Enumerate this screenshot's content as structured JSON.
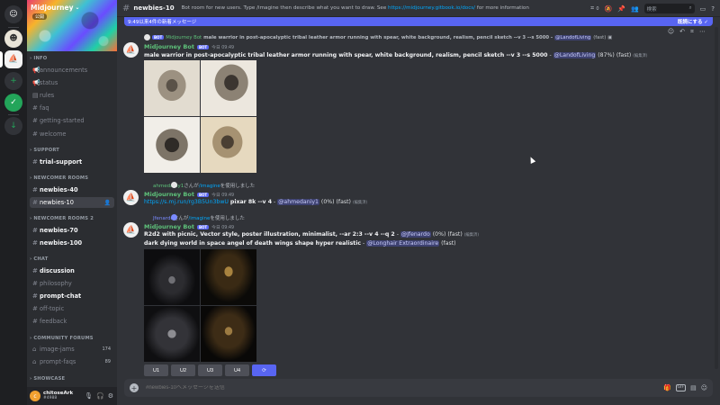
{
  "server": {
    "name": "Midjourney",
    "badge": "公開"
  },
  "categories": {
    "info": "INFO",
    "support": "SUPPORT",
    "newcomer1": "NEWCOMER ROOMS",
    "newcomer2": "NEWCOMER ROOMS 2",
    "chat": "CHAT",
    "forums": "COMMUNITY FORUMS",
    "showcase": "SHOWCASE"
  },
  "channels": {
    "announcements": "announcements",
    "status": "status",
    "rules": "rules",
    "faq": "faq",
    "getting_started": "getting-started",
    "welcome": "welcome",
    "trial_support": "trial-support",
    "newbies40": "newbies-40",
    "newbies10": "newbies-10",
    "newbies70": "newbies-70",
    "newbies100": "newbies-100",
    "discussion": "discussion",
    "philosophy": "philosophy",
    "prompt_chat": "prompt-chat",
    "off_topic": "off-topic",
    "feedback": "feedback",
    "image_jams": "image-jams",
    "image_jams_count": "174",
    "prompt_faqs": "prompt-faqs",
    "prompt_faqs_count": "89"
  },
  "user": {
    "name": "chitoseArk",
    "tag": "#4988",
    "initial": "c"
  },
  "topbar": {
    "channel": "newbies-10",
    "topic_prefix": "Bot room for new users. Type /imagine then describe what you want to draw. See ",
    "topic_link": "https://midjourney.gitbook.io/docs/",
    "topic_suffix": " for more information",
    "search_placeholder": "検索",
    "thread_count": "0"
  },
  "newbar": {
    "text": "9:49以来4件の新着メッセージ",
    "mark": "既読にする"
  },
  "messages": {
    "m1": {
      "reply_author": "Midjourney Bot",
      "reply_badge": "BOT",
      "reply_text": "male warrior in post-apocalyptic tribal leather armor running with spear, white background, realism, pencil sketch --v 3 --s 5000 -",
      "reply_mention": "@LandofLiving",
      "reply_status": "(fast)",
      "author": "Midjourney Bot",
      "badge": "BOT",
      "time": "今日 09:49",
      "prompt": "male warrior in post-apocalyptic tribal leather armor running with spear, white background, realism, pencil sketch --v 3 --s 5000",
      "dash": "-",
      "mention": "@LandofLiving",
      "status": "(87%) (fast)",
      "edited": "(編集済)"
    },
    "sys1": {
      "user": "ahmedaniy1",
      "action": "さんが",
      "command": "/imagine",
      "suffix": "を使用しました"
    },
    "m2": {
      "author": "Midjourney Bot",
      "badge": "BOT",
      "time": "今日 09:49",
      "link": "https://s.mj.run/rg3B5Un3bwU",
      "text": "pixar 8k --v 4",
      "dash": "-",
      "mention": "@ahmedaniy1",
      "status": "(0%) (fast)",
      "edited": "(編集済)"
    },
    "sys2": {
      "user": "Jfenardo",
      "action": "さんが",
      "command": "/imagine",
      "suffix": "を使用しました"
    },
    "m3": {
      "author": "Midjourney Bot",
      "badge": "BOT",
      "time": "今日 09:49",
      "prompt": "R2d2 with picnic, Vector style, poster illustration, minimalist, --ar 2:3 --v 4 --q 2",
      "dash": "-",
      "mention": "@Jfenardo",
      "status": "(0%) (fast)",
      "edited": "(編集済)"
    },
    "m4": {
      "prompt": "dark dying world in space angel of death wings shape hyper realistic",
      "dash": "-",
      "mention": "@Longhair Extraordinaire",
      "status": "(fast)"
    },
    "buttons": [
      "U1",
      "U2",
      "U3",
      "U4"
    ],
    "reroll_icon": "refresh-icon"
  },
  "input": {
    "placeholder": "#newbies-10へメッセージを送信"
  },
  "colors": {
    "accent": "#5865f2",
    "bot_name": "#5ec27a",
    "link": "#00a8fc"
  }
}
